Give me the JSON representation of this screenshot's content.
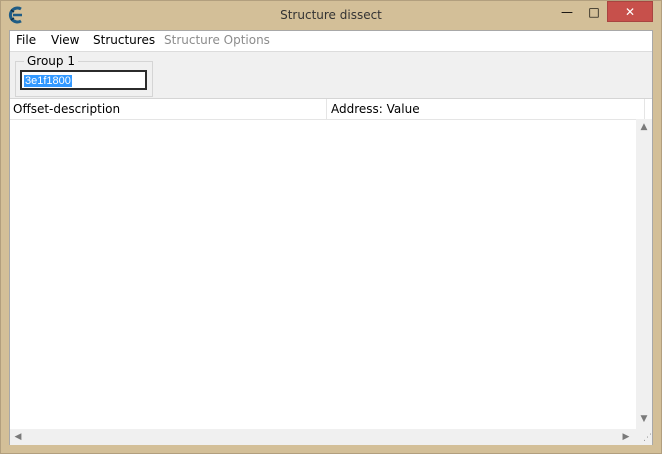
{
  "window": {
    "title": "Structure dissect"
  },
  "title_buttons": {
    "minimize": "—",
    "maximize": "□",
    "close": "✕"
  },
  "menu": {
    "items": [
      {
        "label": "File",
        "enabled": true
      },
      {
        "label": "View",
        "enabled": true
      },
      {
        "label": "Structures",
        "enabled": true
      },
      {
        "label": "Structure Options",
        "enabled": false
      }
    ]
  },
  "group": {
    "label": "Group 1",
    "address_value": "3e1f1800"
  },
  "table": {
    "columns": [
      "Offset-description",
      "Address: Value"
    ],
    "rows": []
  },
  "scrollbars": {
    "up": "▲",
    "down": "▼",
    "left": "◀",
    "right": "▶"
  },
  "colors": {
    "frame": "#d3bf98",
    "close": "#c7504b",
    "selection": "#3399ff",
    "disabled_text": "#8c8c8c"
  }
}
